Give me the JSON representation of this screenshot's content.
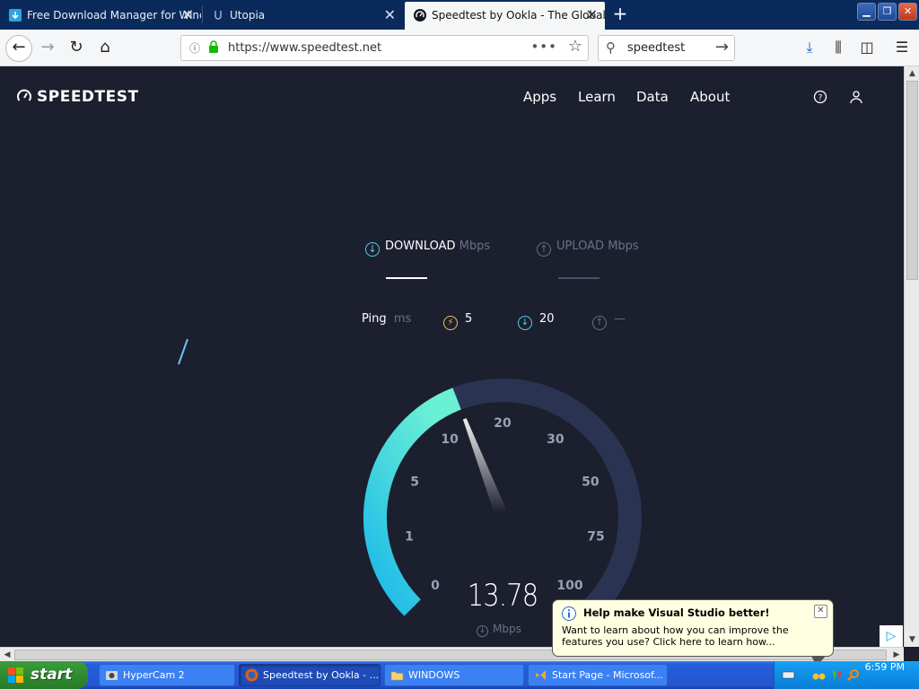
{
  "browser": {
    "tabs": [
      {
        "title": "Free Download Manager for Wind",
        "active": false
      },
      {
        "title": "Utopia",
        "active": false
      },
      {
        "title": "Speedtest by Ookla - The Global B",
        "active": true
      }
    ],
    "url": "https://www.speedtest.net",
    "search_text": "speedtest"
  },
  "site": {
    "logo": "SPEEDTEST",
    "nav": [
      "Apps",
      "Learn",
      "Data",
      "About"
    ]
  },
  "test": {
    "download_label": "DOWNLOAD",
    "download_unit": "Mbps",
    "upload_label": "UPLOAD",
    "upload_unit": "Mbps",
    "ping_label": "Ping",
    "ping_unit": "ms",
    "ping_value": "5",
    "download_ping": "20",
    "upload_ping": "—"
  },
  "gauge": {
    "speed": "13.78",
    "unit": "Mbps",
    "scale": [
      "0",
      "1",
      "5",
      "10",
      "20",
      "30",
      "50",
      "75",
      "100"
    ],
    "needle_value": 13.78,
    "colors": {
      "fill_start": "#1ab7ea",
      "fill_end": "#6af0d4",
      "track": "#2a3452"
    }
  },
  "notification": {
    "title": "Help make Visual Studio better!",
    "body": "Want to learn about how you can improve the features you use? Click here to learn how..."
  },
  "taskbar": {
    "start": "start",
    "tasks": [
      "HyperCam 2",
      "Speedtest by Ookla - ...",
      "WINDOWS",
      "Start Page - Microsof..."
    ],
    "clock": "6:59 PM"
  }
}
